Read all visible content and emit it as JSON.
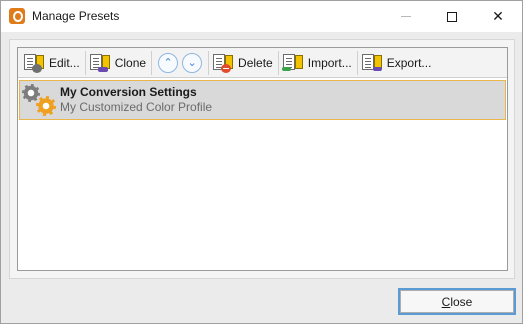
{
  "window": {
    "title": "Manage Presets"
  },
  "toolbar": {
    "edit_label": "Edit...",
    "clone_label": "Clone",
    "delete_label": "Delete",
    "import_label": "Import...",
    "export_label": "Export..."
  },
  "presets": [
    {
      "name": "My Conversion Settings",
      "description": "My Customized Color Profile",
      "selected": true
    }
  ],
  "footer": {
    "close_label_first": "C",
    "close_label_rest": "lose"
  },
  "colors": {
    "selection_border": "#e8b64a",
    "selection_fill": "#d9d9d9",
    "default_button_border": "#5b9bd5",
    "app_icon": "#e07b1a"
  }
}
